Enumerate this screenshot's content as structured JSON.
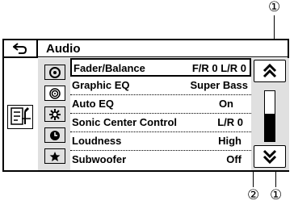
{
  "header": {
    "title": "Audio",
    "back_icon": "back-arrow-icon"
  },
  "callouts": {
    "top_right": "①",
    "bottom_left": "②",
    "bottom_right": "①"
  },
  "sources": [
    {
      "icon": "disc-icon",
      "selected": false
    },
    {
      "icon": "cd-icon",
      "selected": true
    },
    {
      "icon": "settings-icon",
      "selected": false
    },
    {
      "icon": "clock-icon",
      "selected": false
    },
    {
      "icon": "star-icon",
      "selected": false
    }
  ],
  "menu": {
    "items": [
      {
        "label": "Fader/Balance",
        "value": "F/R  0 L/R  0"
      },
      {
        "label": "Graphic EQ",
        "value": "Super Bass"
      },
      {
        "label": "Auto EQ",
        "value": "On"
      },
      {
        "label": "Sonic Center Control",
        "value": "L/R  0"
      },
      {
        "label": "Loudness",
        "value": "High"
      },
      {
        "label": "Subwoofer",
        "value": "Off"
      }
    ]
  },
  "scrollbar": {
    "up_icon": "double-chevron-up-icon",
    "down_icon": "double-chevron-down-icon",
    "position_fraction": 0.55
  }
}
